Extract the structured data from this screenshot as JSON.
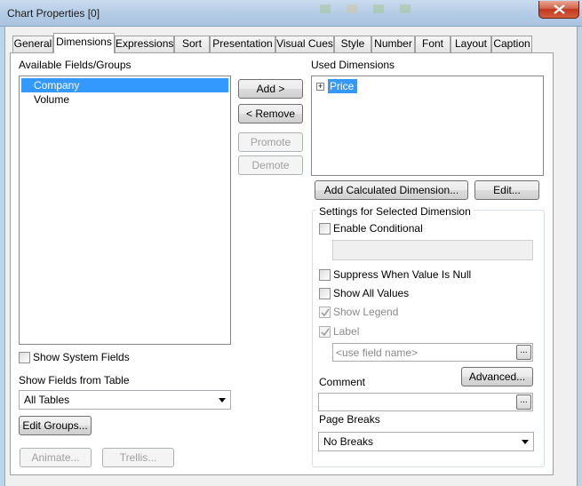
{
  "window": {
    "title": "Chart Properties [0]"
  },
  "tabs": [
    "General",
    "Dimensions",
    "Expressions",
    "Sort",
    "Presentation",
    "Visual Cues",
    "Style",
    "Number",
    "Font",
    "Layout",
    "Caption"
  ],
  "active_tab": "Dimensions",
  "available": {
    "label": "Available Fields/Groups",
    "items": [
      "Company",
      "Volume"
    ],
    "selected": "Company"
  },
  "used": {
    "label": "Used Dimensions",
    "items": [
      "Price"
    ],
    "expander": "+"
  },
  "buttons": {
    "add": "Add >",
    "remove": "< Remove",
    "promote": "Promote",
    "demote": "Demote",
    "add_calculated": "Add Calculated Dimension...",
    "edit": "Edit...",
    "edit_groups": "Edit Groups...",
    "animate": "Animate...",
    "trellis": "Trellis...",
    "advanced": "Advanced...",
    "ellipsis": "..."
  },
  "left_options": {
    "show_system_fields": "Show System Fields",
    "show_fields_from_table_label": "Show Fields from Table",
    "show_fields_from_table_value": "All Tables"
  },
  "settings": {
    "group_title": "Settings for Selected Dimension",
    "enable_conditional": "Enable Conditional",
    "suppress_null": "Suppress When Value Is Null",
    "show_all_values": "Show All Values",
    "show_legend": "Show Legend",
    "label": "Label",
    "label_placeholder": "<use field name>",
    "comment": "Comment",
    "page_breaks": "Page Breaks",
    "page_breaks_value": "No Breaks"
  },
  "checkbox_states": {
    "show_system_fields": false,
    "enable_conditional": false,
    "suppress_null": false,
    "show_all_values": false,
    "show_legend": true,
    "label": true
  },
  "colors": {
    "selection": "#3399ff",
    "close_button": "#c1371f"
  }
}
